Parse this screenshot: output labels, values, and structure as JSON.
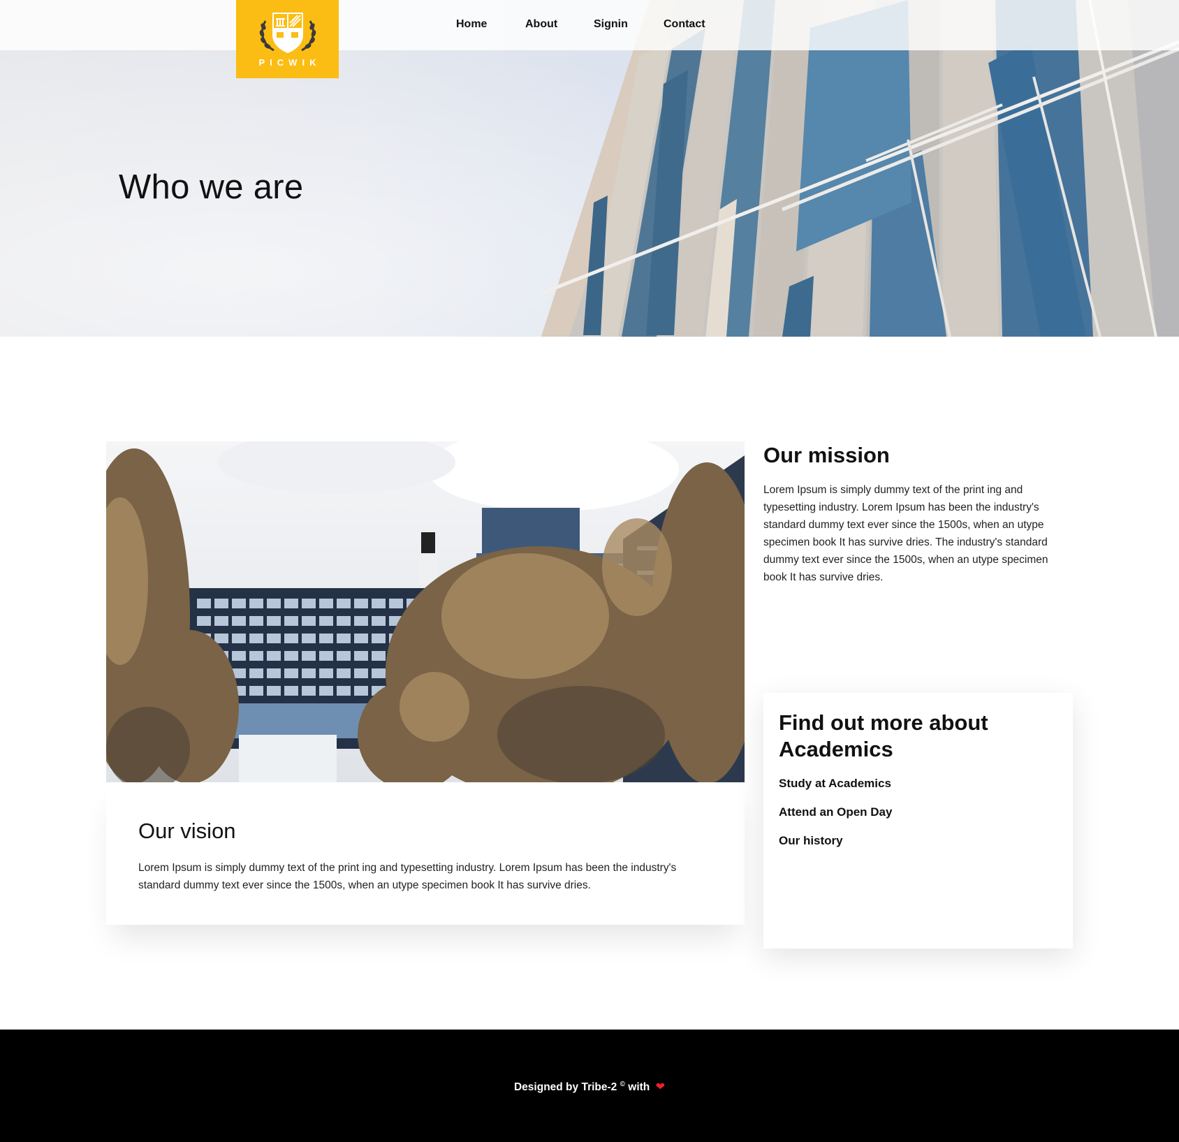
{
  "brand": {
    "name": "PICWIK",
    "color": "#fbbd13"
  },
  "nav": {
    "home": "Home",
    "about": "About",
    "signin": "Signin",
    "contact": "Contact"
  },
  "hero": {
    "title": "Who we are"
  },
  "mission": {
    "title": "Our mission",
    "text": "Lorem Ipsum is simply dummy text of the print ing and typesetting industry. Lorem Ipsum has been the industry's standard dummy text ever since the 1500s, when an utype specimen book It has survive dries. The industry's standard dummy text ever since the 1500s, when an utype specimen book It has survive dries."
  },
  "vision": {
    "title": "Our vision",
    "text": "Lorem Ipsum is simply dummy text of the print ing and typesetting industry. Lorem Ipsum has been the industry's standard dummy text ever since the 1500s, when an utype specimen book It has survive dries."
  },
  "find_more": {
    "title": "Find out more about Academics",
    "links": [
      "Study at Academics",
      "Attend an Open Day",
      "Our history"
    ]
  },
  "footer": {
    "prefix": "Designed by Tribe-2",
    "copyright": "©",
    "suffix": "with",
    "heart_icon": "heart-icon",
    "heart_color": "#e8232a"
  }
}
